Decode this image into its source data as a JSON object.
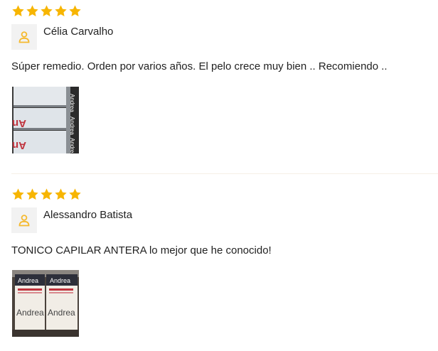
{
  "reviews": [
    {
      "rating": 5,
      "author": "Célia Carvalho",
      "text": "Súper remedio. Orden por varios años. El pelo crece muy bien .. Recomiendo ..",
      "photo_label": "Andrea"
    },
    {
      "rating": 5,
      "author": "Alessandro Batista",
      "text": "TONICO CAPILAR ANTERA lo mejor que he conocido!",
      "photo_label": "Andrea"
    }
  ],
  "colors": {
    "star": "#f7b500",
    "avatar_icon": "#f5b92e",
    "avatar_bg": "#f2f2f2",
    "divider": "#f6efe6"
  }
}
